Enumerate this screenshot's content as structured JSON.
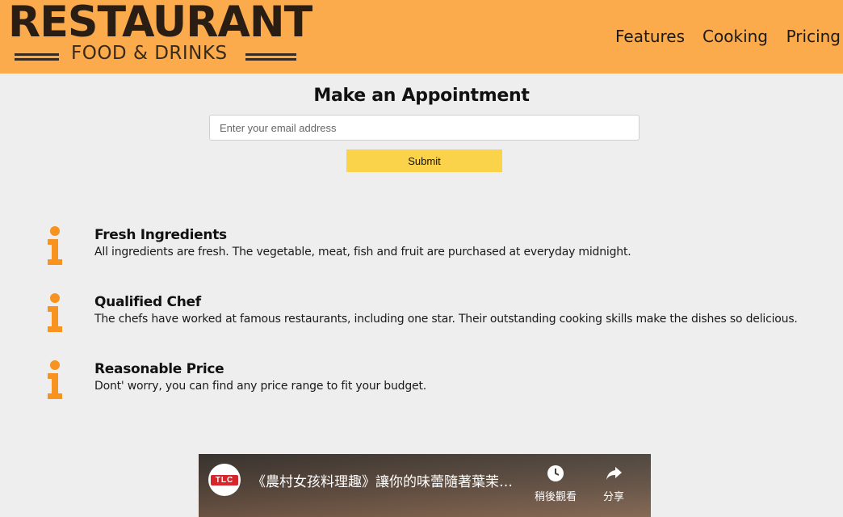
{
  "header": {
    "logo_title": "RESTAURANT",
    "logo_subtitle": "FOOD & DRINKS",
    "nav": [
      "Features",
      "Cooking",
      "Pricing"
    ]
  },
  "appointment": {
    "title": "Make an Appointment",
    "email_placeholder": "Enter your email address",
    "submit_label": "Submit"
  },
  "features": [
    {
      "title": "Fresh Ingredients",
      "text": "All ingredients are fresh. The vegetable, meat, fish and fruit are purchased at everyday midnight.",
      "icon": "info-icon"
    },
    {
      "title": "Qualified Chef",
      "text": "The chefs have worked at famous restaurants, including one star. Their outstanding cooking skills make the dishes so delicious.",
      "icon": "info-icon"
    },
    {
      "title": "Reasonable Price",
      "text": "Dont' worry, you can find any price range to fit your budget.",
      "icon": "info-icon"
    }
  ],
  "video": {
    "channel_logo": "TLC",
    "title": "《農村女孩料理趣》讓你的味蕾隨著葉茉…",
    "watch_later_label": "稍後觀看",
    "share_label": "分享"
  },
  "colors": {
    "header_bg": "#fbab4b",
    "page_bg": "#eeeeee",
    "submit_bg": "#fad34a",
    "icon_color": "#f7931e"
  }
}
